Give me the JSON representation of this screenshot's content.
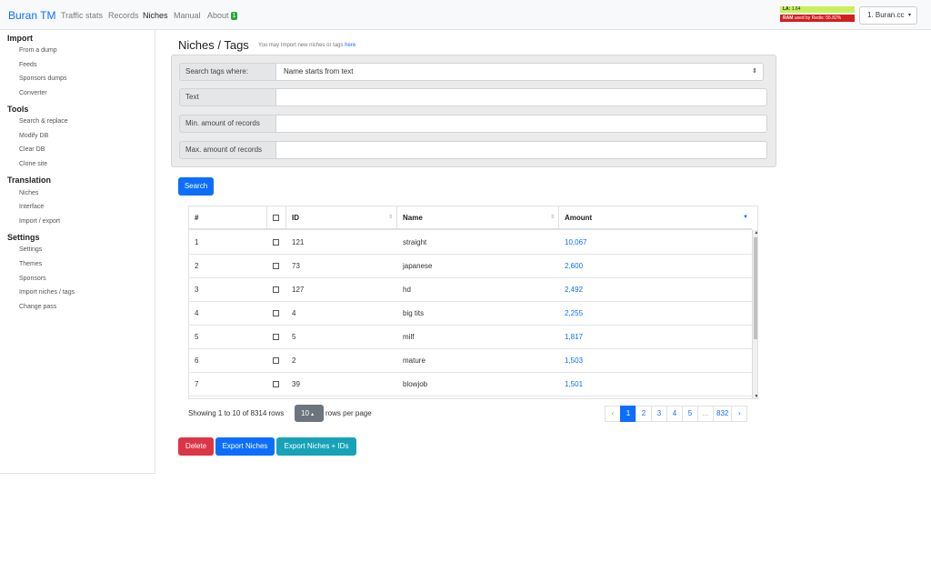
{
  "navbar": {
    "brand": "Buran TM",
    "links": [
      "Traffic stats",
      "Records",
      "Niches",
      "Manual",
      "About"
    ],
    "about_badge": "1",
    "la_label": "LA:",
    "la_value": "1.64",
    "ram_label": "RAM",
    "ram_text": "used by Redis: 55.82%",
    "site": "1. Buran.cc",
    "site_caret": "▾"
  },
  "sidebar": {
    "sections": [
      {
        "title": "Import",
        "items": [
          "From a dump",
          "Feeds",
          "Sponsors dumps",
          "Converter"
        ]
      },
      {
        "title": "Tools",
        "items": [
          "Search & replace",
          "Modify DB",
          "Clear DB",
          "Clone site"
        ]
      },
      {
        "title": "Translation",
        "items": [
          "Niches",
          "Interface",
          "Import / export"
        ]
      },
      {
        "title": "Settings",
        "items": [
          "Settings",
          "Themes",
          "Sponsors",
          "Import niches / tags",
          "Change pass"
        ]
      }
    ]
  },
  "page": {
    "title": "Niches / Tags",
    "note": "You may Import new niches or tags",
    "note_link": "here"
  },
  "filters": {
    "search_where_label": "Search tags where:",
    "search_where_value": "Name starts from text",
    "text_label": "Text",
    "text_value": "",
    "min_label": "Min. amount of records",
    "min_value": "",
    "max_label": "Max. amount of records",
    "max_value": "",
    "search_button": "Search"
  },
  "table": {
    "headers": [
      "#",
      "",
      "ID",
      "Name",
      "Amount"
    ],
    "rows": [
      {
        "n": "1",
        "id": "121",
        "name": "straight",
        "amount": "10,067"
      },
      {
        "n": "2",
        "id": "73",
        "name": "japanese",
        "amount": "2,600"
      },
      {
        "n": "3",
        "id": "127",
        "name": "hd",
        "amount": "2,492"
      },
      {
        "n": "4",
        "id": "4",
        "name": "big tits",
        "amount": "2,255"
      },
      {
        "n": "5",
        "id": "5",
        "name": "milf",
        "amount": "1,817"
      },
      {
        "n": "6",
        "id": "2",
        "name": "mature",
        "amount": "1,503"
      },
      {
        "n": "7",
        "id": "39",
        "name": "blowjob",
        "amount": "1,501"
      }
    ]
  },
  "footer": {
    "showing": "Showing 1 to 10 of 8314 rows",
    "per_page": "10",
    "rows_per_page": "rows per page",
    "pages": [
      "‹",
      "1",
      "2",
      "3",
      "4",
      "5",
      "...",
      "832",
      "›"
    ],
    "active_page": "1"
  },
  "actions": {
    "delete": "Delete",
    "export": "Export Niches",
    "export_ids": "Export Niches + IDs"
  },
  "colors": {
    "primary": "#0d6efd",
    "danger": "#dc3545",
    "info": "#17a2b8",
    "badge": "#28a745"
  }
}
